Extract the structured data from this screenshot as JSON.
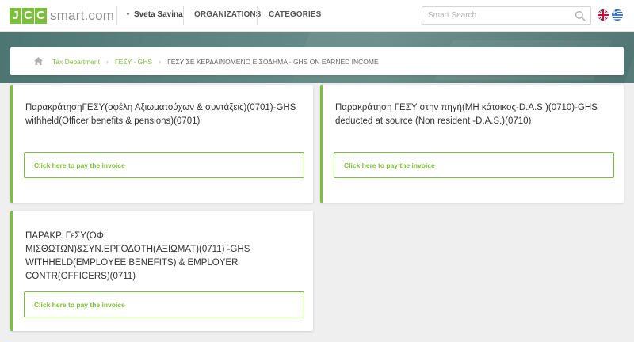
{
  "header": {
    "logo_letters": [
      "J",
      "C",
      "C"
    ],
    "logo_text": "smart.com",
    "user_name": "Sveta Savina",
    "nav": [
      "ORGANIZATIONS",
      "CATEGORIES"
    ],
    "search_placeholder": "Smart Search",
    "languages": [
      "uk-flag-icon",
      "greece-flag-icon"
    ]
  },
  "breadcrumb": {
    "items": [
      "Tax Department",
      "ΓΕΣΥ - GHS"
    ],
    "current": "ΓΕΣΥ ΣΕ ΚΕΡΔΑΙΝΟΜΕΝΟ ΕΙΣΟΔΗΜΑ - GHS ON EARNED INCOME"
  },
  "cards": [
    {
      "title": "ΠαρακράτησηΓΕΣΥ(οφέλη Αξιωματούχων & συντάξεις)(0701)-GHS withheld(Officer benefits & pensions)(0701)",
      "button": "Click here to pay the invoice"
    },
    {
      "title": "Παρακράτηση ΓΕΣΥ στην πηγή(ΜΗ κάτοικος-D.A.S.)(0710)-GHS deducted at source (Non resident -D.A.S.)(0710)",
      "button": "Click here to pay the invoice"
    },
    {
      "title": "ΠΑΡΑΚΡ. ΓεΣΥ(ΟΦ. ΜΙΣΘΩΤΩΝ)&ΣΥΝ.ΕΡΓΟΔΟΤΗ(ΑΞΙΩΜΑΤ)(0711) -GHS WITHHELD(EMPLOYEE BENEFITS) & EMPLOYER CONTR(OFFICERS)(0711)",
      "button": "Click here to pay the invoice"
    }
  ],
  "colors": {
    "brand_green": "#7bbf3a",
    "banner_teal": "#5e8582",
    "background": "#efefef"
  }
}
